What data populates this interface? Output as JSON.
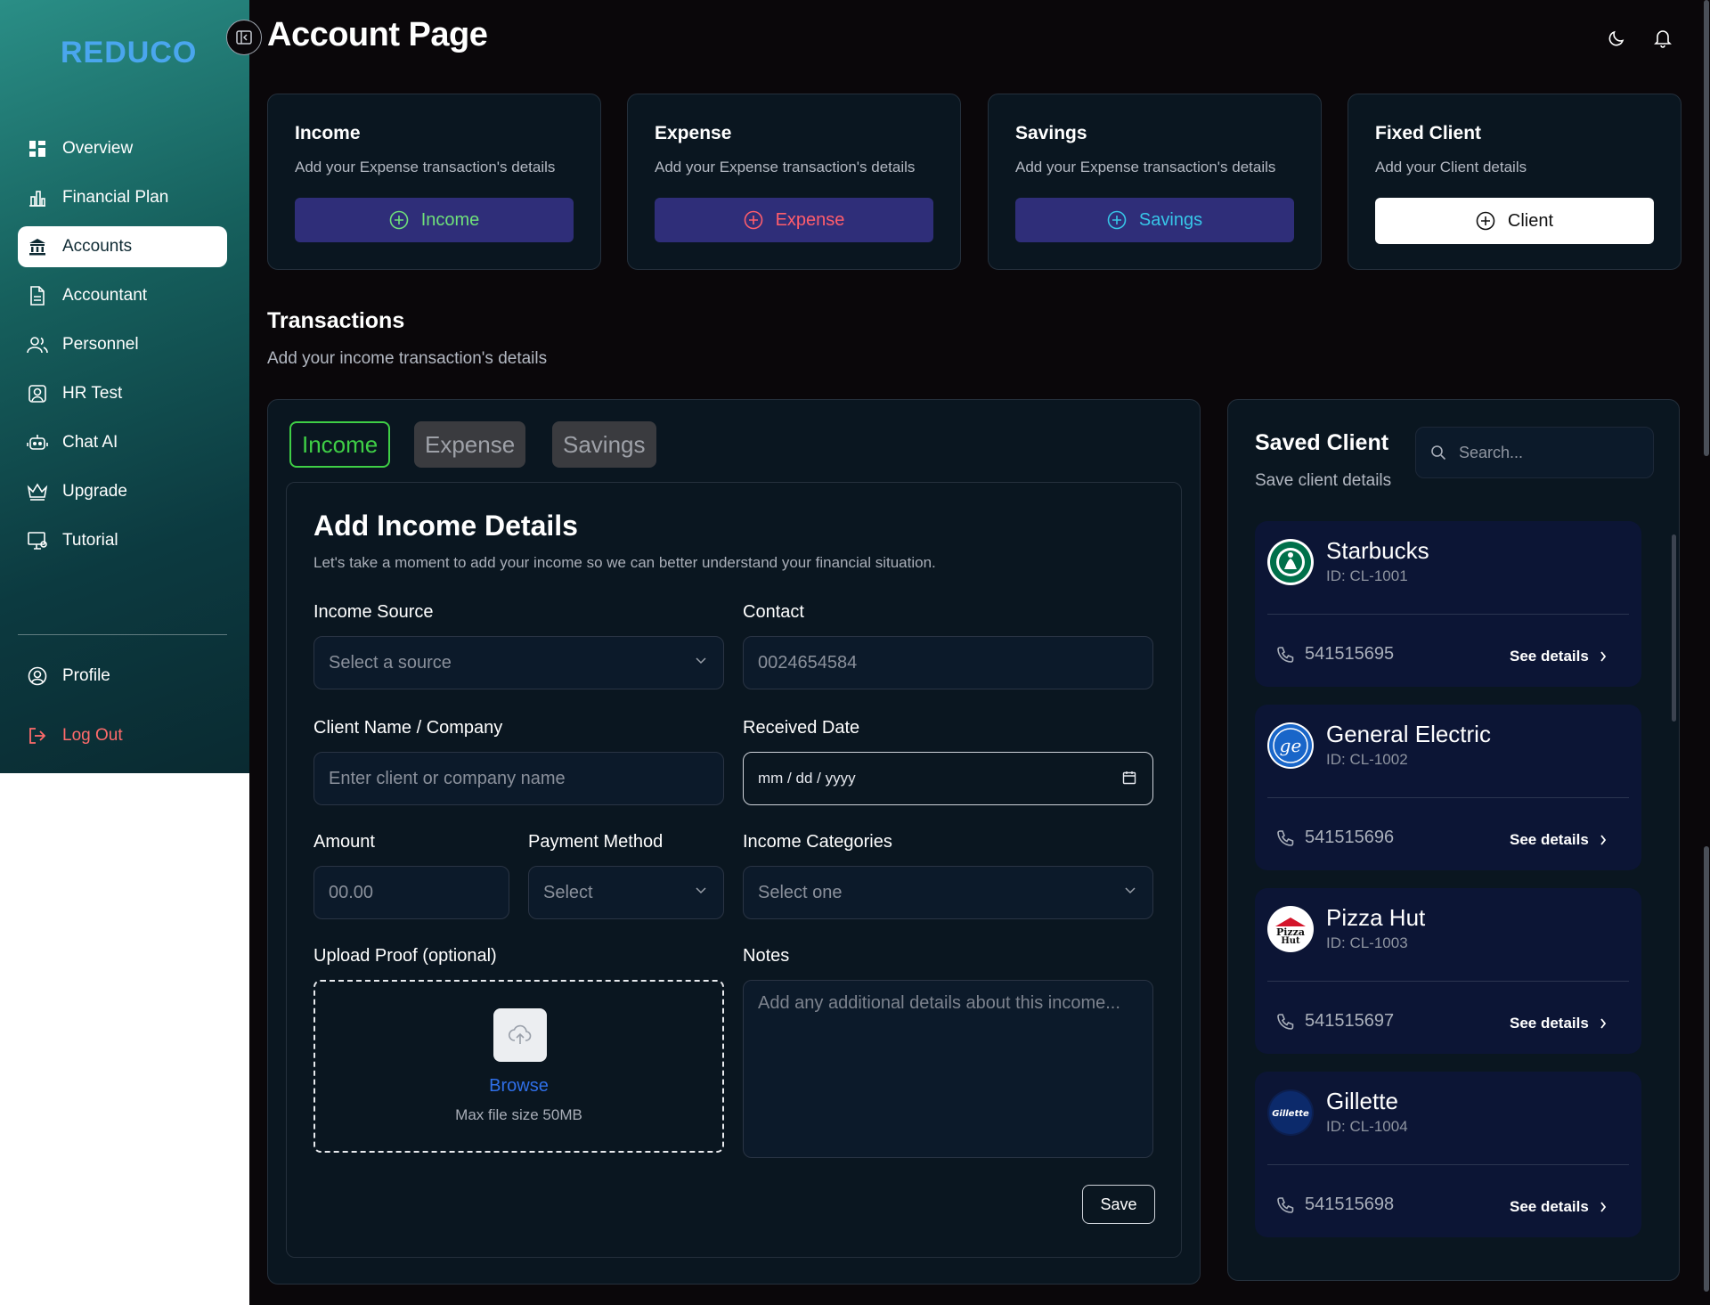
{
  "app": {
    "logo": "REDUCO",
    "page_title": "Account Page"
  },
  "sidebar": {
    "items": [
      {
        "label": "Overview",
        "icon": "dashboard-icon",
        "active": false
      },
      {
        "label": "Financial Plan",
        "icon": "chart-icon",
        "active": false
      },
      {
        "label": "Accounts",
        "icon": "bank-icon",
        "active": true
      },
      {
        "label": "Accountant",
        "icon": "document-icon",
        "active": false
      },
      {
        "label": "Personnel",
        "icon": "users-icon",
        "active": false
      },
      {
        "label": "HR Test",
        "icon": "id-card-icon",
        "active": false
      },
      {
        "label": "Chat AI",
        "icon": "robot-icon",
        "active": false
      },
      {
        "label": "Upgrade",
        "icon": "crown-icon",
        "active": false
      },
      {
        "label": "Tutorial",
        "icon": "monitor-icon",
        "active": false
      }
    ],
    "bottom": [
      {
        "label": "Profile",
        "icon": "user-circle-icon"
      },
      {
        "label": "Log Out",
        "icon": "logout-icon"
      }
    ]
  },
  "cards": [
    {
      "title": "Income",
      "desc": "Add your Expense transaction's details",
      "button": "Income",
      "button_color": "#6fe07a"
    },
    {
      "title": "Expense",
      "desc": "Add your Expense transaction's details",
      "button": "Expense",
      "button_color": "#ff5d6c"
    },
    {
      "title": "Savings",
      "desc": "Add your Expense transaction's details",
      "button": "Savings",
      "button_color": "#37c6e8"
    },
    {
      "title": "Fixed Client",
      "desc": "Add your Client details",
      "button": "Client",
      "button_color": "#111111"
    }
  ],
  "transactions": {
    "title": "Transactions",
    "subtitle": "Add your income transaction's details",
    "tabs": [
      "Income",
      "Expense",
      "Savings"
    ],
    "active_tab": "Income"
  },
  "form": {
    "title": "Add Income Details",
    "subtitle": "Let's take a moment to add your income so we can better understand your financial situation.",
    "income_source": {
      "label": "Income Source",
      "placeholder": "Select a source"
    },
    "contact": {
      "label": "Contact",
      "value": "0024654584"
    },
    "client_name": {
      "label": "Client Name / Company",
      "placeholder": "Enter client or company name"
    },
    "received_date": {
      "label": "Received Date",
      "placeholder": "mm / dd / yyyy"
    },
    "amount": {
      "label": "Amount",
      "placeholder": "00.00"
    },
    "payment_method": {
      "label": "Payment Method",
      "placeholder": "Select"
    },
    "income_categories": {
      "label": "Income Categories",
      "placeholder": "Select one"
    },
    "upload": {
      "label": "Upload Proof (optional)",
      "browse": "Browse",
      "max": "Max file size 50MB"
    },
    "notes": {
      "label": "Notes",
      "placeholder": "Add any additional details about this income..."
    },
    "save": "Save"
  },
  "saved_clients": {
    "title": "Saved Client",
    "subtitle": "Save client details",
    "search_placeholder": "Search...",
    "see_details": "See details",
    "clients": [
      {
        "name": "Starbucks",
        "id": "ID: CL-1001",
        "phone": "541515695"
      },
      {
        "name": "General Electric",
        "id": "ID: CL-1002",
        "phone": "541515696"
      },
      {
        "name": "Pizza Hut",
        "id": "ID: CL-1003",
        "phone": "541515697"
      },
      {
        "name": "Gillette",
        "id": "ID: CL-1004",
        "phone": "541515698"
      }
    ]
  },
  "colors": {
    "accent_green": "#3fcf46",
    "logout_red": "#ff6b6b",
    "browse_blue": "#2f6fe8",
    "button_bg": "#2f2e79"
  }
}
